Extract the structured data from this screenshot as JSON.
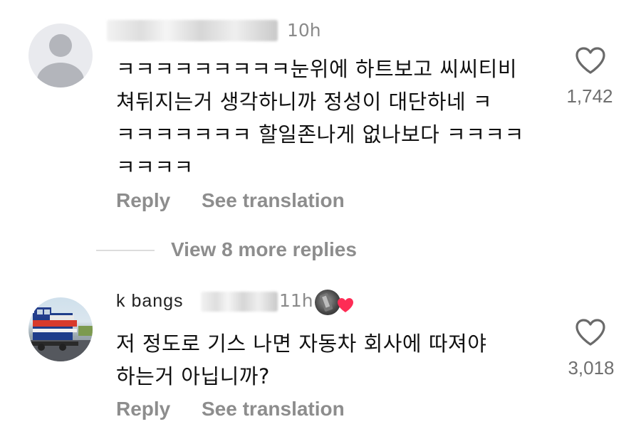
{
  "comments": [
    {
      "time": "10h",
      "text_lines": [
        "ㅋㅋㅋㅋㅋㅋㅋㅋㅋ눈위에 하트보고 씨씨티비",
        "쳐뒤지는거 생각하니까 정성이 대단하네 ㅋ",
        "ㅋㅋㅋㅋㅋㅋㅋ 할일존나게 없나보다 ㅋㅋㅋㅋ",
        "ㅋㅋㅋㅋ"
      ],
      "likes": "1,742",
      "reply_label": "Reply",
      "translate_label": "See translation",
      "icons": {
        "avatar": "default-user-avatar",
        "like": "heart-outline-icon"
      }
    },
    {
      "username_visible": "k bangs",
      "time": "11h",
      "text_lines": [
        "저 정도로 기스 나면 자동차 회사에 따져야",
        "하는거 아닙니까?"
      ],
      "likes": "3,018",
      "reply_label": "Reply",
      "translate_label": "See translation",
      "icons": {
        "avatar": "train-photo-avatar",
        "creator_liked": "red-heart-icon",
        "like": "heart-outline-icon"
      }
    }
  ],
  "view_more_replies": "View 8 more replies",
  "colors": {
    "secondary_text": "#8d8d8d",
    "liked_heart": "#fe2c55"
  }
}
